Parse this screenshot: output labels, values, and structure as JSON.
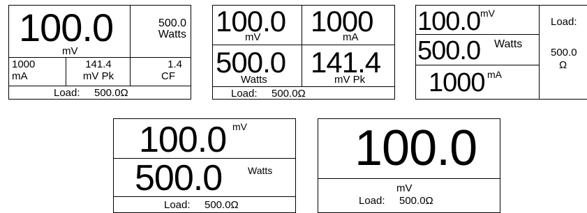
{
  "panel1": {
    "main_value": "100.0",
    "main_unit": "mV",
    "side_value": "500.0",
    "side_unit": "Watts",
    "cells": [
      {
        "value": "1000",
        "unit": "mA"
      },
      {
        "value": "141.4",
        "unit": "mV Pk"
      },
      {
        "value": "1.4",
        "unit": "CF"
      }
    ],
    "load_label": "Load:",
    "load_value": "500.0Ω"
  },
  "panel2": {
    "cells": [
      {
        "value": "100.0",
        "unit": "mV"
      },
      {
        "value": "1000",
        "unit": "mA"
      },
      {
        "value": "500.0",
        "unit": "Watts"
      },
      {
        "value": "141.4",
        "unit": "mV Pk"
      }
    ],
    "load_label": "Load:",
    "load_value": "500.0Ω"
  },
  "panel3": {
    "rows": [
      {
        "value": "100.0",
        "unit": "mV"
      },
      {
        "value": "500.0",
        "unit": "Watts"
      },
      {
        "value": "1000",
        "unit": "mA"
      }
    ],
    "load_label": "Load:",
    "load_value": "500.0",
    "load_unit": "Ω"
  },
  "panel4": {
    "rows": [
      {
        "value": "100.0",
        "unit": "mV"
      },
      {
        "value": "500.0",
        "unit": "Watts"
      }
    ],
    "load_label": "Load:",
    "load_value": "500.0Ω"
  },
  "panel5": {
    "main_value": "100.0",
    "main_unit": "mV",
    "load_label": "Load:",
    "load_value": "500.0Ω"
  }
}
